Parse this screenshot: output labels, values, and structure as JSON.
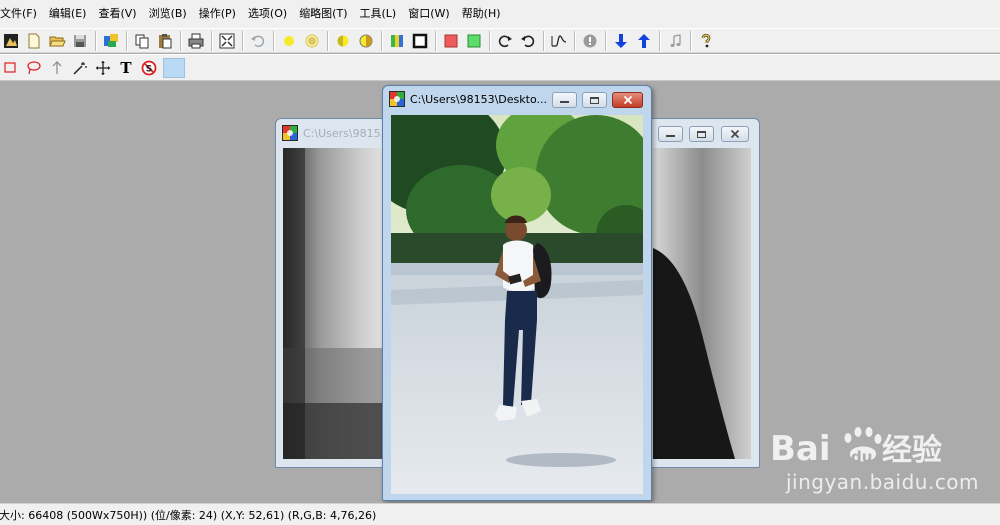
{
  "menu": [
    "文件(F)",
    "编辑(E)",
    "查看(V)",
    "浏览(B)",
    "操作(P)",
    "选项(O)",
    "缩略图(T)",
    "工具(L)",
    "窗口(W)",
    "帮助(H)"
  ],
  "toolbar1": {
    "icons": [
      "open-image-icon",
      "new-file-icon",
      "open-folder-icon",
      "save-icon",
      "scan-icon",
      "copy-icon",
      "paste-icon",
      "print-icon",
      "fit-window-icon",
      "undo-icon",
      "brightness-down-icon",
      "brightness-up-icon",
      "contrast-down-icon",
      "contrast-up-icon",
      "color-palette-icon",
      "crop-icon",
      "red-color-icon",
      "green-color-icon",
      "rotate-right-icon",
      "rotate-left-icon",
      "curve-icon",
      "info-icon",
      "arrow-down-icon",
      "arrow-up-icon",
      "music-icon",
      "help-icon"
    ]
  },
  "toolbar2": {
    "icons": [
      "rectangle-select-icon",
      "lasso-select-icon",
      "arrow-tool-icon",
      "magic-wand-icon",
      "move-tool-icon",
      "text-tool-icon",
      "no-entry-icon",
      "color-swatch"
    ],
    "text_tool_glyph": "T",
    "swatch_color": "#b9d8f3"
  },
  "windows": {
    "back": {
      "title": "C:\\Users\\98153"
    },
    "front": {
      "title": "C:\\Users\\98153\\Deskto..."
    }
  },
  "statusbar": {
    "text": "大小: 66408 (500Wx750H)) (位/像素: 24) (X,Y: 52,61) (R,G,B: 4,76,26)"
  },
  "watermark": {
    "brand": "Bai",
    "brand_du": "du",
    "brand_suffix": "经验",
    "url": "jingyan.baidu.com"
  },
  "colors": {
    "workspace": "#ababab",
    "chrome": "#f0f0f0",
    "active_frame": "#bfd6ec",
    "inactive_frame": "#dde6ef",
    "close_button": "#c8412c"
  }
}
